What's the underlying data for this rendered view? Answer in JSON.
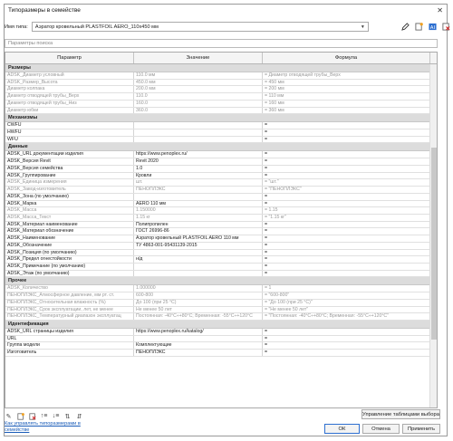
{
  "window": {
    "title": "Типоразмеры в семействе",
    "close_glyph": "✕"
  },
  "type_selector": {
    "label": "Имя типа:",
    "value": "Аэратор кровельный PLASTFOIL AERO_110x450 мм"
  },
  "toolbar_icons": [
    "pencil-icon",
    "new-type-icon",
    "rename-type-icon",
    "delete-type-icon"
  ],
  "search": {
    "placeholder": "Параметры поиска"
  },
  "columns": [
    "Параметр",
    "Значение",
    "Формула"
  ],
  "groups": [
    {
      "name": "Размеры",
      "rows": [
        {
          "p": "ADSK_Диаметр условный",
          "v": "110.0 мм",
          "f": "= Диаметр отводящей трубы_Верх",
          "grey": true
        },
        {
          "p": "ADSK_Размер_Высота",
          "v": "450.0 мм",
          "f": "= 450 мм",
          "grey": true
        },
        {
          "p": "Диаметр колпака",
          "v": "200.0 мм",
          "f": "= 200 мм",
          "grey": true
        },
        {
          "p": "Диаметр отводящей трубы_Верх",
          "v": "110.0",
          "f": "= 110 мм",
          "grey": true
        },
        {
          "p": "Диаметр отводящей трубы_Низ",
          "v": "160.0",
          "f": "= 160 мм",
          "grey": true
        },
        {
          "p": "Диаметр юбки",
          "v": "360.0",
          "f": "= 360 мм",
          "grey": true
        }
      ]
    },
    {
      "name": "Механизмы",
      "rows": [
        {
          "p": "CWFU",
          "v": "",
          "f": "=",
          "grey": false
        },
        {
          "p": "HWFU",
          "v": "",
          "f": "=",
          "grey": false
        },
        {
          "p": "WFU",
          "v": "",
          "f": "=",
          "grey": false
        }
      ]
    },
    {
      "name": "Данные",
      "rows": [
        {
          "p": "ADSK_URL документации изделия",
          "v": "https://www.penoplex.ru/",
          "f": "=",
          "grey": false
        },
        {
          "p": "ADSK_Версия Revit",
          "v": "Revit 2020",
          "f": "=",
          "grey": false
        },
        {
          "p": "ADSK_Версия семейства",
          "v": "1.0",
          "f": "=",
          "grey": false
        },
        {
          "p": "ADSK_Группирование",
          "v": "Кровли",
          "f": "=",
          "grey": false
        },
        {
          "p": "ADSK_Единица измерения",
          "v": "шт.",
          "f": "= \"шт.\"",
          "grey": true
        },
        {
          "p": "ADSK_Завод-изготовитель",
          "v": "ПЕНОПЛЭКС",
          "f": "= \"ПЕНОПЛЭКС\"",
          "grey": true
        },
        {
          "p": "ADSK_Зона (по умолчанию)",
          "v": "",
          "f": "=",
          "grey": false
        },
        {
          "p": "ADSK_Марка",
          "v": "AERO 110 мм",
          "f": "=",
          "grey": false
        },
        {
          "p": "ADSK_Масса",
          "v": "1.150000",
          "f": "= 1.15",
          "grey": true
        },
        {
          "p": "ADSK_Масса_Текст",
          "v": "1.15 кг",
          "f": "= \"1.15 кг\"",
          "grey": true
        },
        {
          "p": "ADSK_Материал наименование",
          "v": "Полипропилен",
          "f": "=",
          "grey": false
        },
        {
          "p": "ADSK_Материал обозначение",
          "v": "ГОСТ 26996-86",
          "f": "=",
          "grey": false
        },
        {
          "p": "ADSK_Наименование",
          "v": "Аэратор кровельный PLASTFOIL AERO 110 мм",
          "f": "=",
          "grey": false
        },
        {
          "p": "ADSK_Обозначение",
          "v": "ТУ 4863-001-95431139-2015",
          "f": "=",
          "grey": false
        },
        {
          "p": "ADSK_Позиция (по умолчанию)",
          "v": "",
          "f": "=",
          "grey": false
        },
        {
          "p": "ADSK_Предел огнестойкости",
          "v": "н/д",
          "f": "=",
          "grey": false
        },
        {
          "p": "ADSK_Примечание (по умолчанию)",
          "v": "",
          "f": "=",
          "grey": false
        },
        {
          "p": "ADSK_Этаж (по умолчанию)",
          "v": "",
          "f": "=",
          "grey": false
        }
      ]
    },
    {
      "name": "Прочее",
      "rows": [
        {
          "p": "ADSK_Количество",
          "v": "1.000000",
          "f": "= 1",
          "grey": true
        },
        {
          "p": "ПЕНОПЛЭКС_Атмосферное давление, мм рт. ст.",
          "v": "600-800",
          "f": "= \"600-800\"",
          "grey": true
        },
        {
          "p": "ПЕНОПЛЭКС_Относительная влажность (%)",
          "v": "До 100 (при 25 °С)",
          "f": "= \"До 100 (при 25 °С)\"",
          "grey": true
        },
        {
          "p": "ПЕНОПЛЭКС_Срок эксплуатации, лет, не менее",
          "v": "Не менее 50 лет",
          "f": "= \"Не менее 50 лет\"",
          "grey": true
        },
        {
          "p": "ПЕНОПЛЭКС_Температурный диапазон эксплуатац",
          "v": "Постоянная: -40°С÷+80°С; Временная: -55°С÷+120°С",
          "f": "= \"Постоянная: -40°С÷+80°С; Временная: -55°С÷+120°С\"",
          "grey": true
        }
      ]
    },
    {
      "name": "Идентификация",
      "rows": [
        {
          "p": "ADSK_URL страницы изделия",
          "v": "https://www.penoplex.ru/katalog/",
          "f": "=",
          "grey": false
        },
        {
          "p": "URL",
          "v": "",
          "f": "=",
          "grey": false
        },
        {
          "p": "Группа модели",
          "v": "Комплектующие",
          "f": "=",
          "grey": false
        },
        {
          "p": "Изготовитель",
          "v": "ПЕНОПЛЭКС",
          "f": "=",
          "grey": false
        }
      ]
    }
  ],
  "bottom_icons": [
    "pencil-icon",
    "new-param-icon",
    "delete-param-icon",
    "move-up-icon",
    "move-down-icon",
    "sort-asc-icon",
    "sort-desc-icon"
  ],
  "link": "Как управлять типоразмерами в семействе",
  "buttons": {
    "lookup": "Управление таблицами выбора",
    "ok": "ОК",
    "cancel": "Отмена",
    "apply": "Применить"
  }
}
